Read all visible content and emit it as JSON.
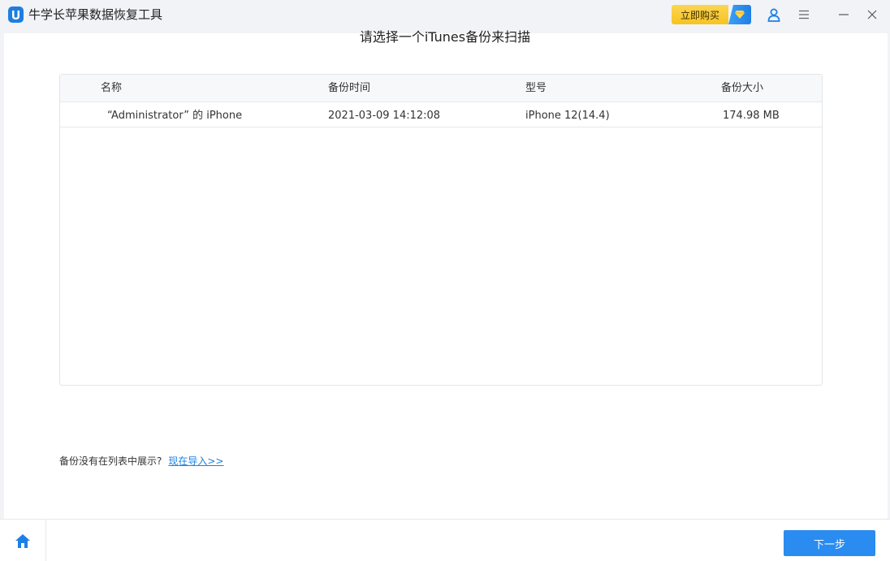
{
  "app": {
    "title": "牛学长苹果数据恢复工具",
    "buy_label": "立即购买",
    "accent_color": "#2a8cf0"
  },
  "titlebar": {
    "icons": [
      "user-icon",
      "menu-icon",
      "minimize-icon",
      "close-icon"
    ]
  },
  "main": {
    "heading": "请选择一个iTunes备份来扫描",
    "table": {
      "headers": [
        "名称",
        "备份时间",
        "型号",
        "备份大小"
      ],
      "rows": [
        {
          "name": "“Administrator” 的 iPhone",
          "time": "2021-03-09 14:12:08",
          "model": "iPhone 12(14.4)",
          "size": "174.98 MB"
        }
      ]
    },
    "footer_note": "备份没有在列表中展示?",
    "import_link": "现在导入>>"
  },
  "bottom": {
    "next_label": "下一步"
  }
}
